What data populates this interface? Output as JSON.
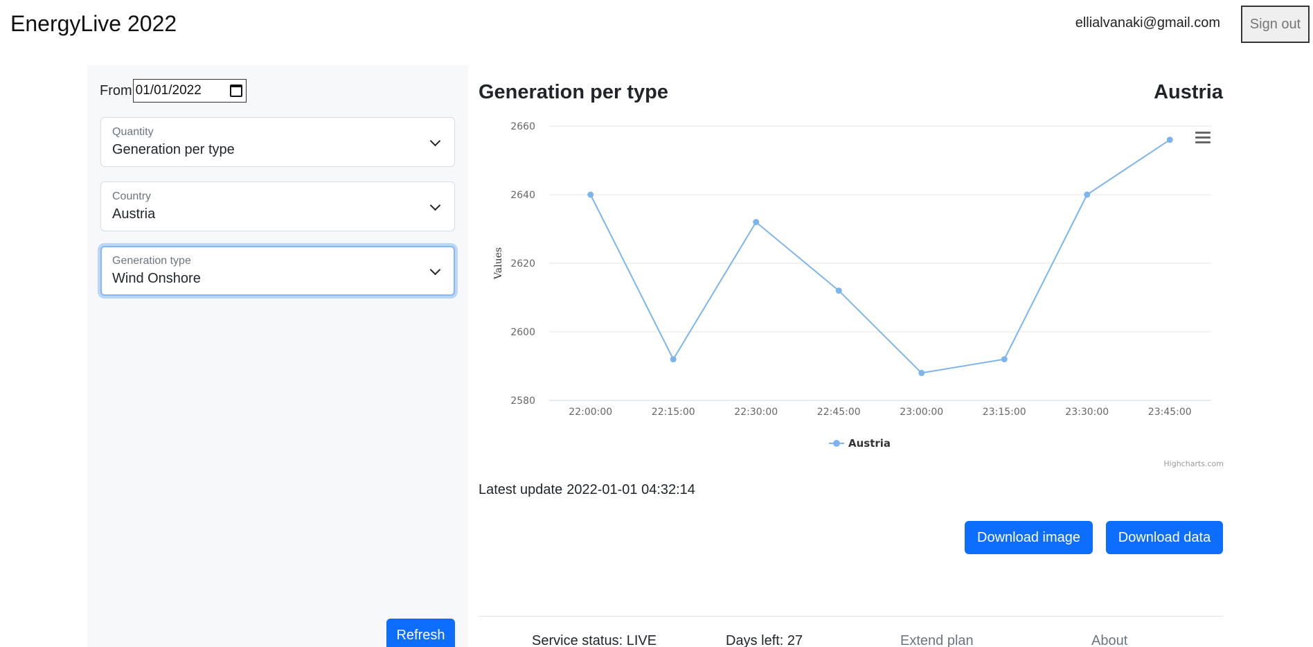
{
  "header": {
    "app_title": "EnergyLive 2022",
    "user_email": "ellialvanaki@gmail.com",
    "signout_label": "Sign out"
  },
  "sidebar": {
    "from_label": "From",
    "from_value": "01/01/2022",
    "selects": [
      {
        "caption": "Quantity",
        "value": "Generation per type"
      },
      {
        "caption": "Country",
        "value": "Austria"
      },
      {
        "caption": "Generation type",
        "value": "Wind Onshore"
      }
    ],
    "refresh_label": "Refresh"
  },
  "main": {
    "chart_title": "Generation per type",
    "chart_country": "Austria",
    "latest_update_label": "Latest update",
    "latest_update_value": "2022-01-01 04:32:14",
    "download_image_label": "Download image",
    "download_data_label": "Download data"
  },
  "footer": {
    "service_status": "Service status: LIVE",
    "days_left": "Days left: 27",
    "extend_plan": "Extend plan",
    "about": "About"
  },
  "chart_data": {
    "type": "line",
    "ylabel": "Values",
    "ylim": [
      2580,
      2660
    ],
    "yticks": [
      "2660",
      "2640",
      "2620",
      "2600",
      "2580"
    ],
    "categories": [
      "22:00:00",
      "22:15:00",
      "22:30:00",
      "22:45:00",
      "23:00:00",
      "23:15:00",
      "23:30:00",
      "23:45:00"
    ],
    "series": [
      {
        "name": "Austria",
        "values": [
          2640,
          2592,
          2632,
          2612,
          2588,
          2592,
          2640,
          2656
        ]
      }
    ],
    "credits": "Highcharts.com",
    "grid": true,
    "legend": "bottom-center",
    "color": "#7cb5ec"
  }
}
